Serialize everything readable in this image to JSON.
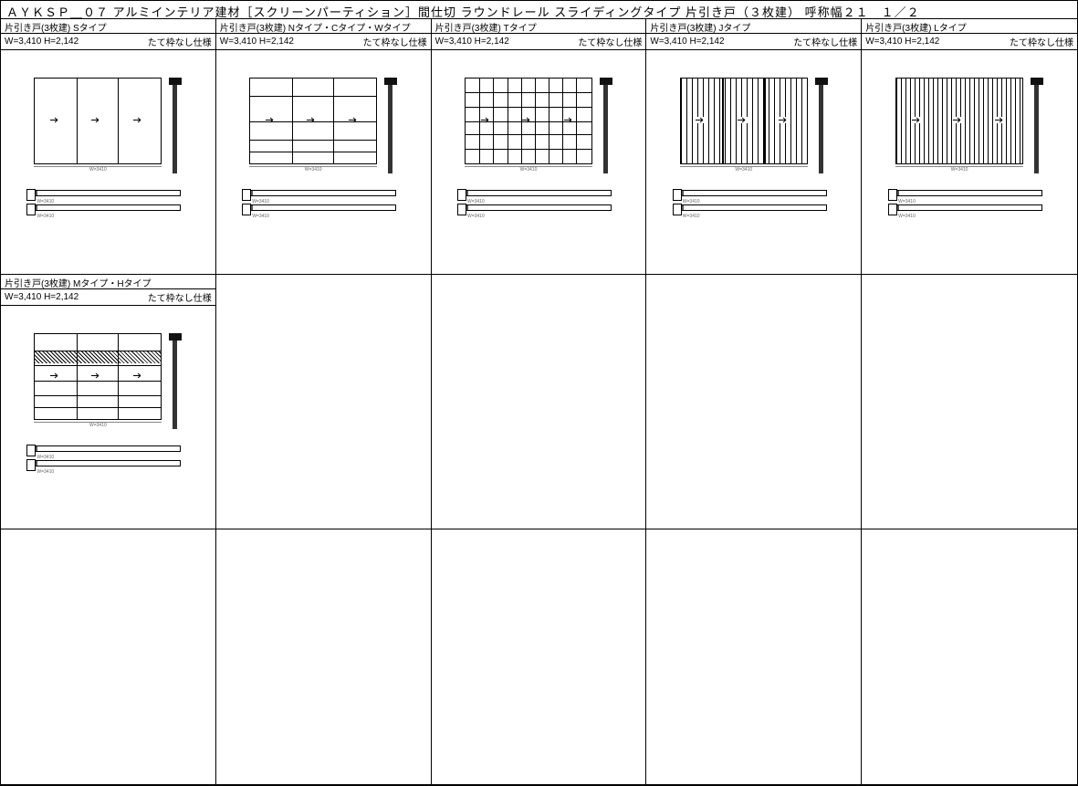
{
  "title": "ＡＹＫＳＰ＿０７ アルミインテリア建材［スクリーンパーティション］間仕切 ラウンドレール スライディングタイプ 片引き戸（３枚建） 呼称幅２１　１／２",
  "dim_label": "W=3,410 H=2,142",
  "spec_label": "たて枠なし仕様",
  "width_dim": "W=3410",
  "cells": [
    {
      "header": "片引き戸(3枚建) Sタイプ",
      "style": "plain"
    },
    {
      "header": "片引き戸(3枚建) Nタイプ・Cタイプ・Wタイプ",
      "style": "n"
    },
    {
      "header": "片引き戸(3枚建) Tタイプ",
      "style": "t"
    },
    {
      "header": "片引き戸(3枚建) Jタイプ",
      "style": "j"
    },
    {
      "header": "片引き戸(3枚建) Lタイプ",
      "style": "l"
    },
    {
      "header": "片引き戸(3枚建) Mタイプ・Hタイプ",
      "style": "m"
    }
  ]
}
